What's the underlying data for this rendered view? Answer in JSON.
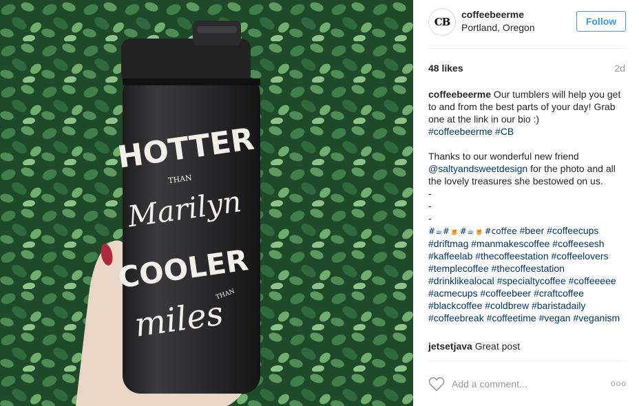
{
  "photo": {
    "tumbler_text": {
      "line1": "HOTTER",
      "than1": "THAN",
      "line2": "Marilyn",
      "line3": "COOLER",
      "than2": "THAN",
      "line4": "miles"
    }
  },
  "header": {
    "avatar_initials": "CB",
    "username": "coffeebeerme",
    "location": "Portland, Oregon",
    "follow_label": "Follow"
  },
  "stats": {
    "likes": "48 likes",
    "age": "2d"
  },
  "caption": {
    "author": "coffeebeerme",
    "text1": " Our tumblers will help you get to and from the best parts of your day! Grab one at the link in our bio :)",
    "tags1": "#coffeebeerme #CB",
    "text2": "Thanks to our wonderful new friend",
    "mention": "@saltyandsweetdesign",
    "text3": " for the photo and all the lovely treasures she bestowed on us.",
    "dash": "-",
    "emoji_tags": "#☕#🍺#☕🍺#coffee",
    "tags2": " #beer #coffeecups #driftmag #manmakescoffee #coffeesesh #kaffeelab #thecoffeestation #coffeelovers #templecoffee #thecoffeestation #drinklikealocal #specialtycoffee #coffeeeee #acmecups #coffeebeer #craftcoffee #blackcoffee #coldbrew #baristadaily #coffeebreak #coffeetime #vegan #veganism"
  },
  "comment": {
    "user": "jetsetjava",
    "text": " Great post"
  },
  "footer": {
    "placeholder": "Add a comment...",
    "more": "ooo"
  }
}
